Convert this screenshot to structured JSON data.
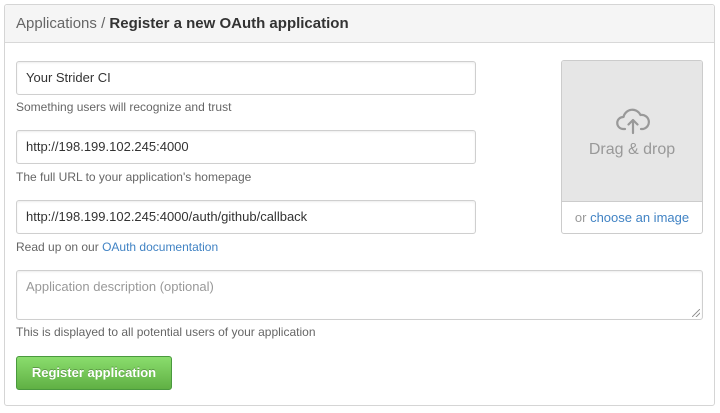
{
  "breadcrumb": {
    "parent": "Applications",
    "separator": "/",
    "title": "Register a new OAuth application"
  },
  "form": {
    "app_name": {
      "value": "Your Strider CI",
      "note": "Something users will recognize and trust"
    },
    "homepage_url": {
      "value": "http://198.199.102.245:4000",
      "note": "The full URL to your application's homepage"
    },
    "callback_url": {
      "value": "http://198.199.102.245:4000/auth/github/callback",
      "note_prefix": "Read up on our ",
      "note_link": "OAuth documentation"
    },
    "description": {
      "placeholder": "Application description (optional)",
      "note": "This is displayed to all potential users of your application"
    },
    "submit_label": "Register application"
  },
  "logo_upload": {
    "icon": "cloud-upload-icon",
    "drop_label": "Drag & drop",
    "choose_prefix": "or ",
    "choose_link": "choose an image"
  },
  "colors": {
    "link": "#4183c4",
    "button_top": "#8add6d",
    "button_bottom": "#60b044",
    "header_bg": "#f5f5f5",
    "drop_bg": "#e6e6e6"
  }
}
